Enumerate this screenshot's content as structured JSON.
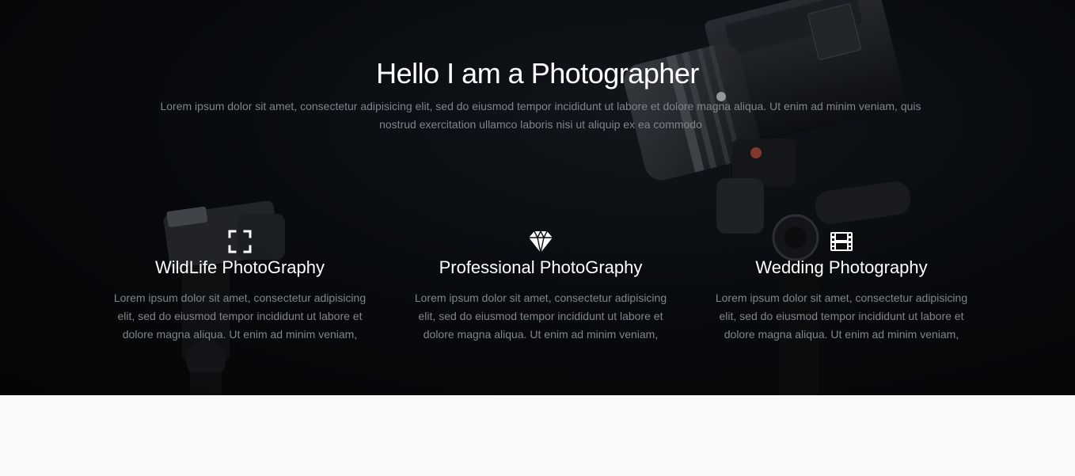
{
  "hero": {
    "title": "Hello I am a Photographer",
    "text": "Lorem ipsum dolor sit amet, consectetur adipisicing elit, sed do eiusmod tempor incididunt ut labore et dolore magna aliqua. Ut enim ad minim veniam, quis nostrud exercitation ullamco laboris nisi ut aliquip ex ea commodo",
    "background_color": "#07090c"
  },
  "services": [
    {
      "icon": "expand-icon",
      "title": "WildLife PhotoGraphy",
      "text": "Lorem ipsum dolor sit amet, consectetur adipisicing elit, sed do eiusmod tempor incididunt ut labore et dolore magna aliqua. Ut enim ad minim veniam,"
    },
    {
      "icon": "diamond-icon",
      "title": "Professional PhotoGraphy",
      "text": "Lorem ipsum dolor sit amet, consectetur adipisicing elit, sed do eiusmod tempor incididunt ut labore et dolore magna aliqua. Ut enim ad minim veniam,"
    },
    {
      "icon": "film-icon",
      "title": "Wedding Photography",
      "text": "Lorem ipsum dolor sit amet, consectetur adipisicing elit, sed do eiusmod tempor incididunt ut labore et dolore magna aliqua. Ut enim ad minim veniam,"
    }
  ]
}
